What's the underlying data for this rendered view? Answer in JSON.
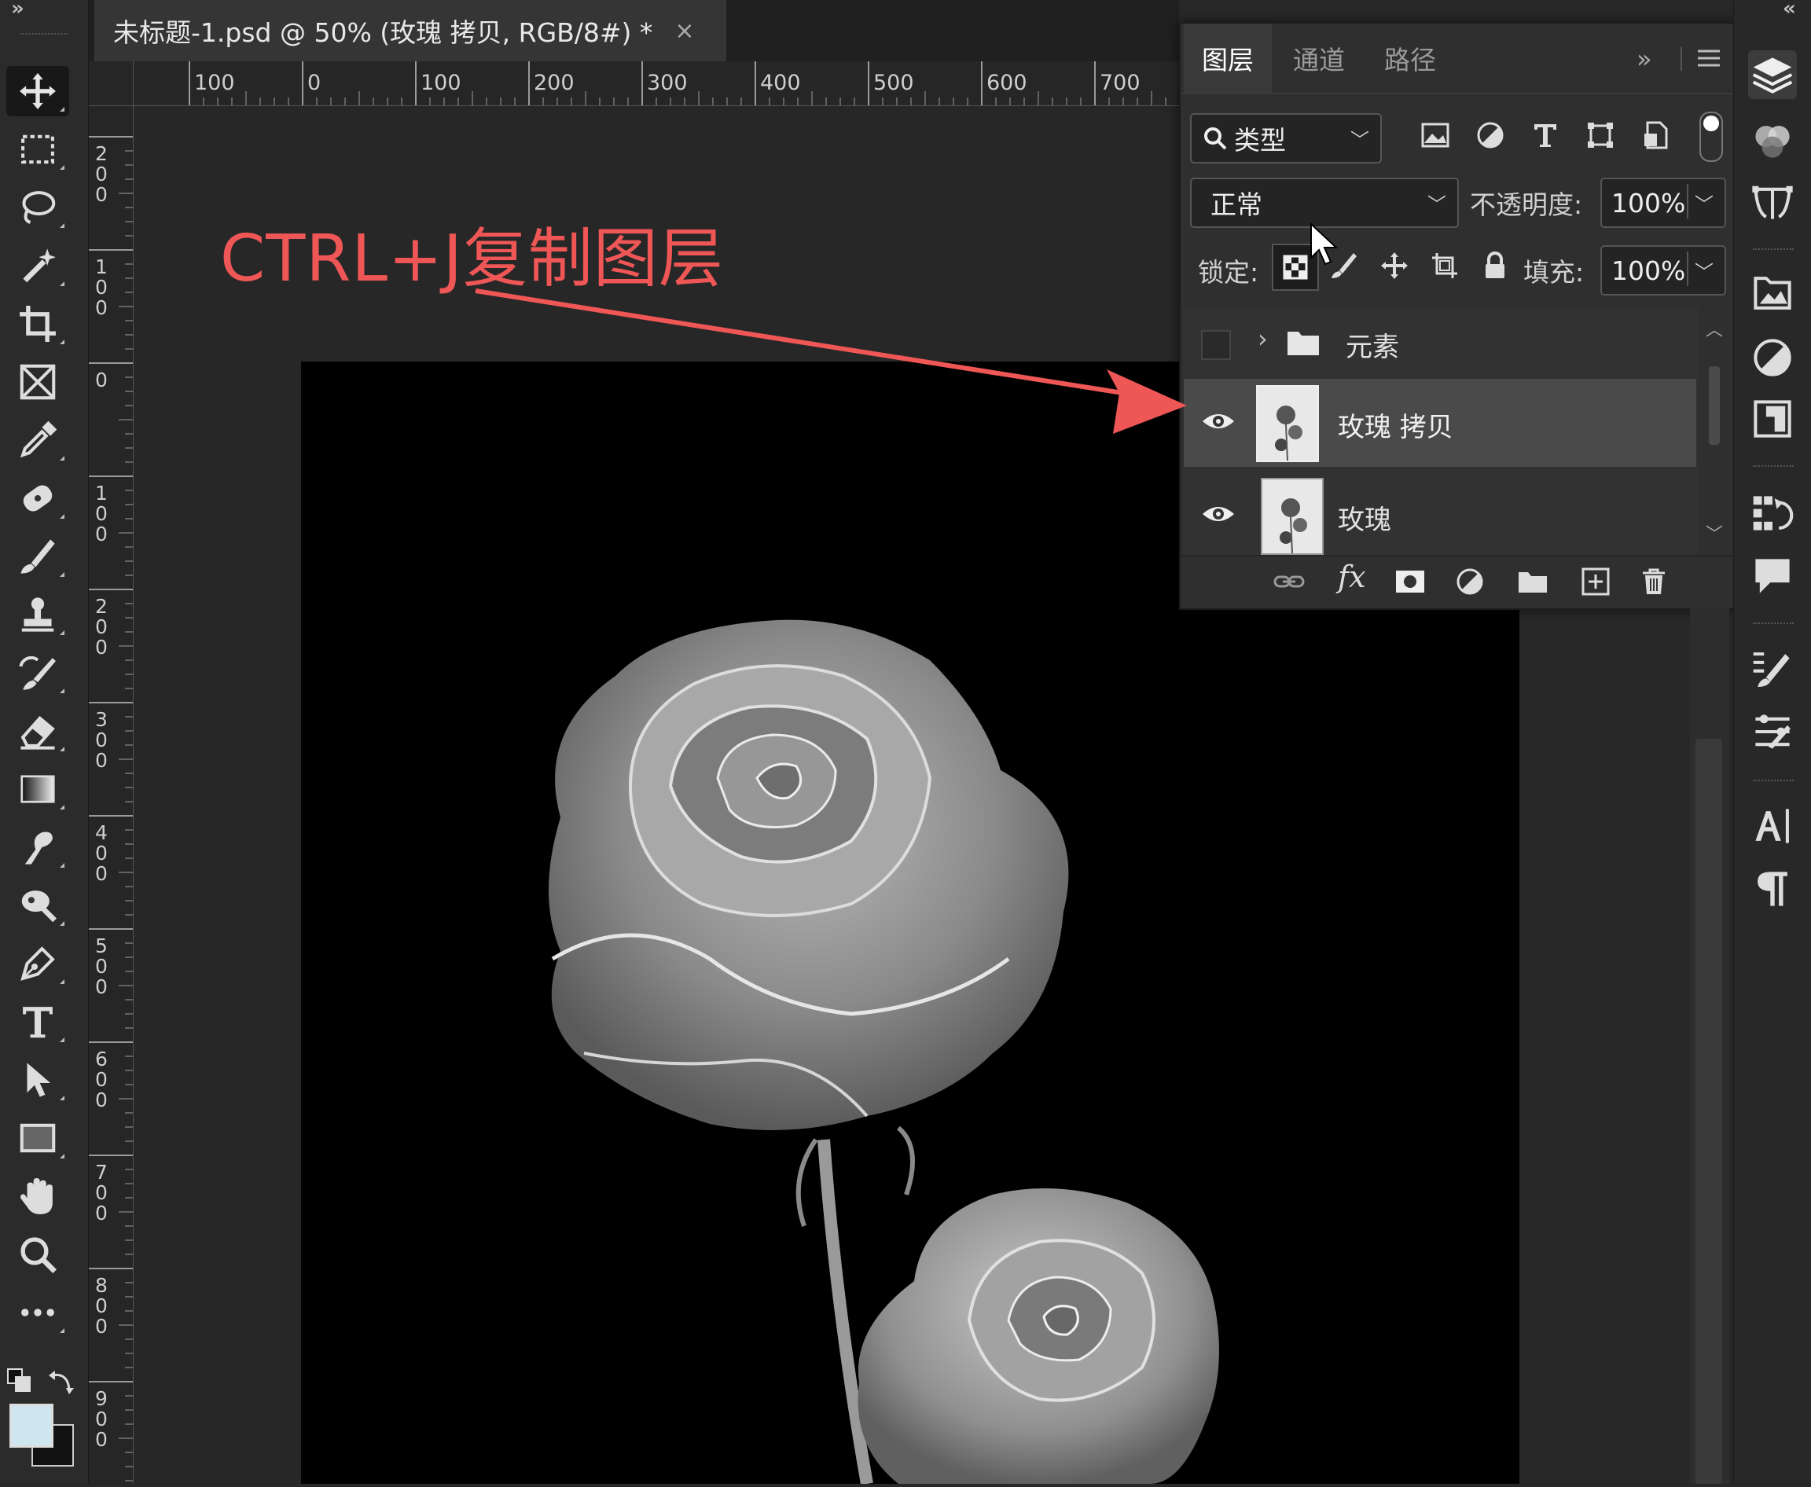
{
  "document": {
    "tab_title": "未标题-1.psd @ 50% (玫瑰 拷贝, RGB/8#) *",
    "close_glyph": "×"
  },
  "toolbar": {
    "collapse_glyph": "»",
    "tools": [
      "move-tool",
      "rect-marquee-tool",
      "lasso-tool",
      "magic-wand-tool",
      "crop-tool",
      "frame-tool",
      "eyedropper-tool",
      "spot-healing-tool",
      "brush-tool",
      "clone-stamp-tool",
      "history-brush-tool",
      "eraser-tool",
      "gradient-tool",
      "smudge-tool",
      "dodge-tool",
      "pen-tool",
      "type-tool",
      "path-selection-tool",
      "rectangle-tool",
      "hand-tool",
      "zoom-tool",
      "more-tools"
    ],
    "colors": {
      "foreground": "#cfe6f0",
      "background": "#111111"
    }
  },
  "rulers": {
    "top": [
      "100",
      "0",
      "100",
      "200",
      "300",
      "400",
      "500",
      "600",
      "700"
    ],
    "left": [
      "200",
      "100",
      "0",
      "100",
      "200",
      "300",
      "400",
      "500",
      "600",
      "700",
      "800",
      "900"
    ]
  },
  "annotation": {
    "text": "CTRL+J复制图层",
    "color": "#ef5656"
  },
  "layers_panel": {
    "tabs": [
      "图层",
      "通道",
      "路径"
    ],
    "more_glyph": "»",
    "filter": {
      "value": "类型"
    },
    "blend_mode": "正常",
    "opacity": {
      "label": "不透明度:",
      "value": "100%"
    },
    "lock": {
      "label": "锁定:"
    },
    "fill": {
      "label": "填充:",
      "value": "100%"
    },
    "layers": [
      {
        "name": "元素",
        "type": "group",
        "visible": false
      },
      {
        "name": "玫瑰 拷贝",
        "type": "image",
        "visible": true,
        "selected": true
      },
      {
        "name": "玫瑰",
        "type": "image",
        "visible": true,
        "selected": false
      }
    ],
    "footer": {
      "fx_label": "fx"
    }
  },
  "right_strip": {
    "collapse_glyph": "«",
    "icons": [
      "layers-icon",
      "channels-icon",
      "paths-icon",
      "libraries-icon",
      "adjustments-icon",
      "properties-icon",
      "history-icon",
      "comments-icon",
      "brush-settings-icon",
      "brush-presets-icon",
      "character-icon",
      "paragraph-icon"
    ]
  }
}
